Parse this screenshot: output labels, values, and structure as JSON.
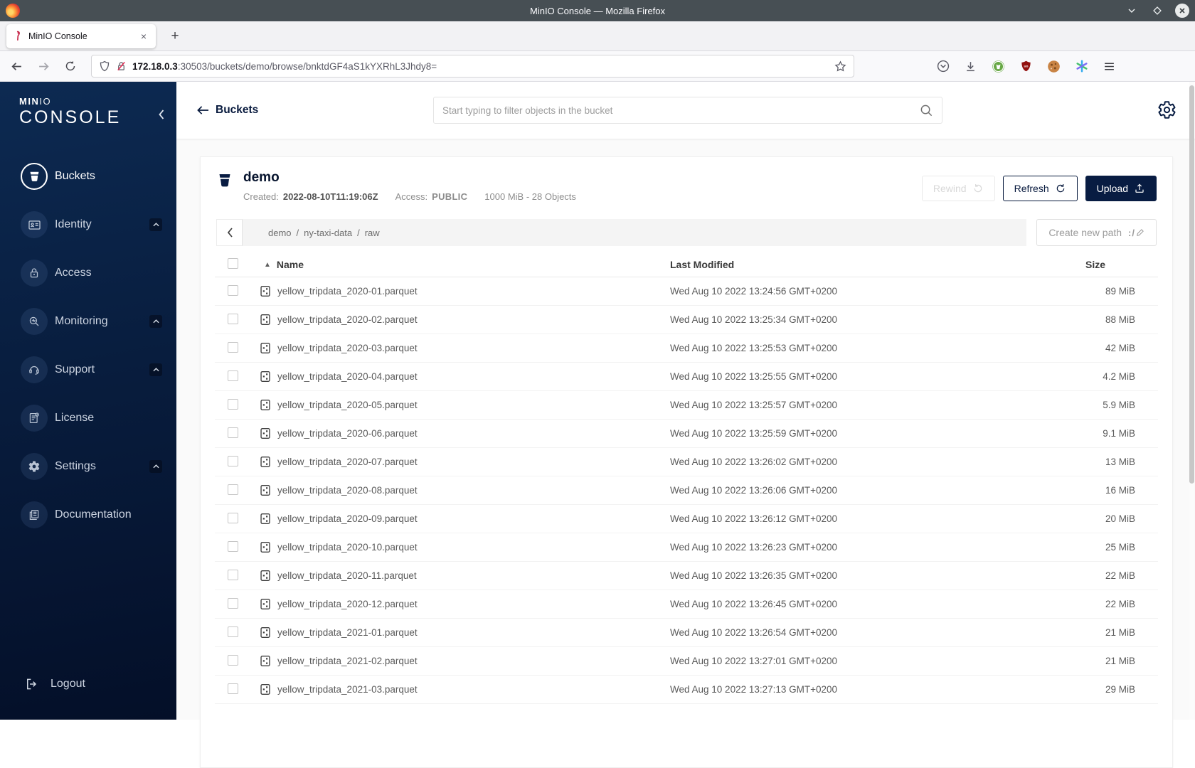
{
  "window": {
    "title": "MinIO Console — Mozilla Firefox"
  },
  "browser": {
    "tab_title": "MinIO Console",
    "tab_close": "×",
    "new_tab": "+",
    "url_host": "172.18.0.3",
    "url_path": ":30503/buckets/demo/browse/bnktdGF4aS1kYXRhL3Jhdy8="
  },
  "sidebar": {
    "logo_bold": "MIN",
    "logo_thin": "IO",
    "logo_word": "CONSOLE",
    "items": [
      {
        "label": "Buckets",
        "icon": "bucket-icon",
        "active": true,
        "expandable": false
      },
      {
        "label": "Identity",
        "icon": "id-card-icon",
        "active": false,
        "expandable": true
      },
      {
        "label": "Access",
        "icon": "lock-icon",
        "active": false,
        "expandable": false
      },
      {
        "label": "Monitoring",
        "icon": "monitoring-icon",
        "active": false,
        "expandable": true
      },
      {
        "label": "Support",
        "icon": "support-icon",
        "active": false,
        "expandable": true
      },
      {
        "label": "License",
        "icon": "license-icon",
        "active": false,
        "expandable": false
      },
      {
        "label": "Settings",
        "icon": "settings-icon",
        "active": false,
        "expandable": true
      },
      {
        "label": "Documentation",
        "icon": "documentation-icon",
        "active": false,
        "expandable": false
      }
    ],
    "logout_label": "Logout"
  },
  "header": {
    "back_label": "Buckets",
    "search_placeholder": "Start typing to filter objects in the bucket"
  },
  "bucket": {
    "name": "demo",
    "created_label": "Created:",
    "created_value": "2022-08-10T11:19:06Z",
    "access_label": "Access:",
    "access_value": "PUBLIC",
    "stats": "1000 MiB - 28 Objects",
    "rewind_label": "Rewind",
    "refresh_label": "Refresh",
    "upload_label": "Upload"
  },
  "path_bar": {
    "breadcrumb_parts": [
      "demo",
      "ny-taxi-data",
      "raw"
    ],
    "separator": "/",
    "create_path_label": "Create new path",
    "create_path_glyph": ":/"
  },
  "table": {
    "headers": {
      "name": "Name",
      "modified": "Last Modified",
      "size": "Size"
    },
    "sort_indicator": "▲",
    "rows": [
      {
        "name": "yellow_tripdata_2020-01.parquet",
        "modified": "Wed Aug 10 2022 13:24:56 GMT+0200",
        "size": "89 MiB"
      },
      {
        "name": "yellow_tripdata_2020-02.parquet",
        "modified": "Wed Aug 10 2022 13:25:34 GMT+0200",
        "size": "88 MiB"
      },
      {
        "name": "yellow_tripdata_2020-03.parquet",
        "modified": "Wed Aug 10 2022 13:25:53 GMT+0200",
        "size": "42 MiB"
      },
      {
        "name": "yellow_tripdata_2020-04.parquet",
        "modified": "Wed Aug 10 2022 13:25:55 GMT+0200",
        "size": "4.2 MiB"
      },
      {
        "name": "yellow_tripdata_2020-05.parquet",
        "modified": "Wed Aug 10 2022 13:25:57 GMT+0200",
        "size": "5.9 MiB"
      },
      {
        "name": "yellow_tripdata_2020-06.parquet",
        "modified": "Wed Aug 10 2022 13:25:59 GMT+0200",
        "size": "9.1 MiB"
      },
      {
        "name": "yellow_tripdata_2020-07.parquet",
        "modified": "Wed Aug 10 2022 13:26:02 GMT+0200",
        "size": "13 MiB"
      },
      {
        "name": "yellow_tripdata_2020-08.parquet",
        "modified": "Wed Aug 10 2022 13:26:06 GMT+0200",
        "size": "16 MiB"
      },
      {
        "name": "yellow_tripdata_2020-09.parquet",
        "modified": "Wed Aug 10 2022 13:26:12 GMT+0200",
        "size": "20 MiB"
      },
      {
        "name": "yellow_tripdata_2020-10.parquet",
        "modified": "Wed Aug 10 2022 13:26:23 GMT+0200",
        "size": "25 MiB"
      },
      {
        "name": "yellow_tripdata_2020-11.parquet",
        "modified": "Wed Aug 10 2022 13:26:35 GMT+0200",
        "size": "22 MiB"
      },
      {
        "name": "yellow_tripdata_2020-12.parquet",
        "modified": "Wed Aug 10 2022 13:26:45 GMT+0200",
        "size": "22 MiB"
      },
      {
        "name": "yellow_tripdata_2021-01.parquet",
        "modified": "Wed Aug 10 2022 13:26:54 GMT+0200",
        "size": "21 MiB"
      },
      {
        "name": "yellow_tripdata_2021-02.parquet",
        "modified": "Wed Aug 10 2022 13:27:01 GMT+0200",
        "size": "21 MiB"
      },
      {
        "name": "yellow_tripdata_2021-03.parquet",
        "modified": "Wed Aug 10 2022 13:27:13 GMT+0200",
        "size": "29 MiB"
      }
    ]
  },
  "colors": {
    "accent_navy": "#081c42",
    "sidebar_top": "#0d2a52",
    "sidebar_bottom": "#040f28",
    "titlebar": "#474f54"
  }
}
